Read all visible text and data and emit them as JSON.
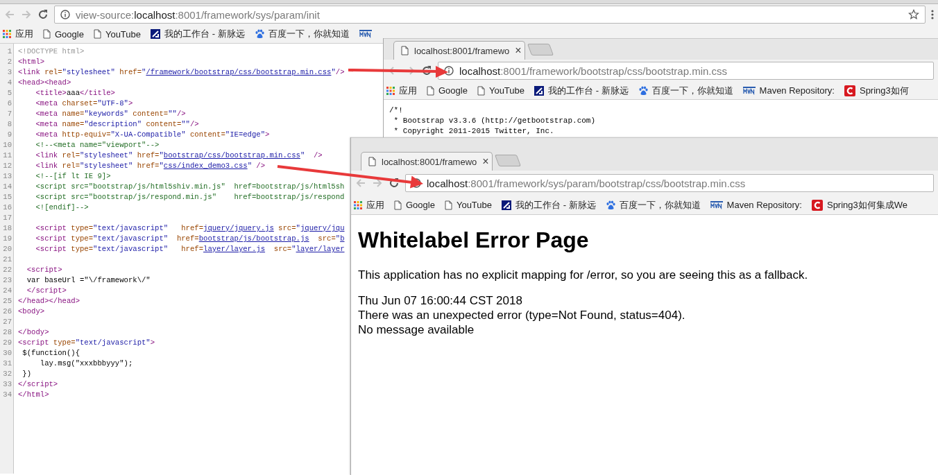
{
  "main_window": {
    "address": {
      "prefix": "view-source:",
      "host": "localhost",
      "path": ":8001/framework/sys/param/init"
    },
    "bookmarks": [
      {
        "kind": "apps",
        "label": "应用"
      },
      {
        "kind": "page",
        "label": "Google"
      },
      {
        "kind": "page",
        "label": "YouTube"
      },
      {
        "kind": "workbench",
        "label": "我的工作台 - 新脉远"
      },
      {
        "kind": "paw",
        "label": "百度一下，你就知道"
      },
      {
        "kind": "mvn"
      }
    ],
    "source_lines": [
      {
        "number": "1",
        "segments": [
          {
            "kind": "doctype",
            "text": "<!DOCTYPE html>"
          }
        ]
      },
      {
        "number": "2",
        "segments": [
          {
            "kind": "tag",
            "text": "<html>"
          }
        ]
      },
      {
        "number": "3",
        "segments": [
          {
            "kind": "tag",
            "text": "<link "
          },
          {
            "kind": "attr",
            "text": "rel="
          },
          {
            "kind": "value",
            "text": "\"stylesheet\" "
          },
          {
            "kind": "attr",
            "text": "href="
          },
          {
            "kind": "value",
            "text": "\""
          },
          {
            "kind": "link",
            "text": "/framework/bootstrap/css/bootstrap.min.css"
          },
          {
            "kind": "value",
            "text": "\""
          },
          {
            "kind": "tag",
            "text": "/>"
          }
        ]
      },
      {
        "number": "4",
        "segments": [
          {
            "kind": "tag",
            "text": "<head><head>"
          }
        ]
      },
      {
        "number": "5",
        "segments": [
          {
            "kind": "tag",
            "text": "    <title>"
          },
          {
            "kind": "text",
            "text": "aaa"
          },
          {
            "kind": "tag",
            "text": "</title>"
          }
        ]
      },
      {
        "number": "6",
        "segments": [
          {
            "kind": "tag",
            "text": "    <meta "
          },
          {
            "kind": "attr",
            "text": "charset="
          },
          {
            "kind": "value",
            "text": "\"UTF-8\""
          },
          {
            "kind": "tag",
            "text": ">"
          }
        ]
      },
      {
        "number": "7",
        "segments": [
          {
            "kind": "tag",
            "text": "    <meta "
          },
          {
            "kind": "attr",
            "text": "name="
          },
          {
            "kind": "value",
            "text": "\"keywords\" "
          },
          {
            "kind": "attr",
            "text": "content="
          },
          {
            "kind": "value",
            "text": "\"\""
          },
          {
            "kind": "tag",
            "text": "/>"
          }
        ]
      },
      {
        "number": "8",
        "segments": [
          {
            "kind": "tag",
            "text": "    <meta "
          },
          {
            "kind": "attr",
            "text": "name="
          },
          {
            "kind": "value",
            "text": "\"description\" "
          },
          {
            "kind": "attr",
            "text": "content="
          },
          {
            "kind": "value",
            "text": "\"\""
          },
          {
            "kind": "tag",
            "text": "/>"
          }
        ]
      },
      {
        "number": "9",
        "segments": [
          {
            "kind": "tag",
            "text": "    <meta "
          },
          {
            "kind": "attr",
            "text": "http-equiv="
          },
          {
            "kind": "value",
            "text": "\"X-UA-Compatible\" "
          },
          {
            "kind": "attr",
            "text": "content="
          },
          {
            "kind": "value",
            "text": "\"IE=edge\""
          },
          {
            "kind": "tag",
            "text": ">"
          }
        ]
      },
      {
        "number": "10",
        "segments": [
          {
            "kind": "comment",
            "text": "    <!--<meta name=\"viewport\"-->"
          }
        ]
      },
      {
        "number": "11",
        "segments": [
          {
            "kind": "tag",
            "text": "    <link "
          },
          {
            "kind": "attr",
            "text": "rel="
          },
          {
            "kind": "value",
            "text": "\"stylesheet\" "
          },
          {
            "kind": "attr",
            "text": "href="
          },
          {
            "kind": "value",
            "text": "\""
          },
          {
            "kind": "link",
            "text": "bootstrap/css/bootstrap.min.css"
          },
          {
            "kind": "value",
            "text": "\"  "
          },
          {
            "kind": "tag",
            "text": "/>"
          }
        ]
      },
      {
        "number": "12",
        "segments": [
          {
            "kind": "tag",
            "text": "    <link "
          },
          {
            "kind": "attr",
            "text": "rel="
          },
          {
            "kind": "value",
            "text": "\"stylesheet\" "
          },
          {
            "kind": "attr",
            "text": "href="
          },
          {
            "kind": "value",
            "text": "\""
          },
          {
            "kind": "link",
            "text": "css/index_demo3.css"
          },
          {
            "kind": "value",
            "text": "\" "
          },
          {
            "kind": "tag",
            "text": "/>"
          }
        ]
      },
      {
        "number": "13",
        "segments": [
          {
            "kind": "comment",
            "text": "    <!--[if lt IE 9]>"
          }
        ]
      },
      {
        "number": "14",
        "segments": [
          {
            "kind": "comment",
            "text": "    <script src=\"bootstrap/js/html5shiv.min.js\"  href=bootstrap/js/html5sh"
          }
        ]
      },
      {
        "number": "15",
        "segments": [
          {
            "kind": "comment",
            "text": "    <script src=\"bootstrap/js/respond.min.js\"    href=bootstrap/js/respond"
          }
        ]
      },
      {
        "number": "16",
        "segments": [
          {
            "kind": "comment",
            "text": "    <![endif]-->"
          }
        ]
      },
      {
        "number": "17"
      },
      {
        "number": "18",
        "segments": [
          {
            "kind": "tag",
            "text": "    <script "
          },
          {
            "kind": "attr",
            "text": "type="
          },
          {
            "kind": "value",
            "text": "\"text/javascript\"   "
          },
          {
            "kind": "attr",
            "text": "href="
          },
          {
            "kind": "link",
            "text": "jquery/jquery.js"
          },
          {
            "kind": "attr",
            "text": " src="
          },
          {
            "kind": "value",
            "text": "\""
          },
          {
            "kind": "link",
            "text": "jquery/jqu"
          }
        ]
      },
      {
        "number": "19",
        "segments": [
          {
            "kind": "tag",
            "text": "    <script "
          },
          {
            "kind": "attr",
            "text": "type="
          },
          {
            "kind": "value",
            "text": "\"text/javascript\"  "
          },
          {
            "kind": "attr",
            "text": "href="
          },
          {
            "kind": "link",
            "text": "bootstrap/js/bootstrap.js"
          },
          {
            "kind": "attr",
            "text": "  src="
          },
          {
            "kind": "value",
            "text": "\""
          },
          {
            "kind": "link",
            "text": "b"
          }
        ]
      },
      {
        "number": "20",
        "segments": [
          {
            "kind": "tag",
            "text": "    <script "
          },
          {
            "kind": "attr",
            "text": "type="
          },
          {
            "kind": "value",
            "text": "\"text/javascript\"   "
          },
          {
            "kind": "attr",
            "text": "href="
          },
          {
            "kind": "link",
            "text": "layer/layer.js"
          },
          {
            "kind": "attr",
            "text": "  src="
          },
          {
            "kind": "value",
            "text": "\""
          },
          {
            "kind": "link",
            "text": "layer/layer"
          }
        ]
      },
      {
        "number": "21"
      },
      {
        "number": "22",
        "segments": [
          {
            "kind": "tag",
            "text": "  <script>"
          }
        ]
      },
      {
        "number": "23",
        "segments": [
          {
            "kind": "text",
            "text": "  var baseUrl =\"\\/framework\\/\""
          }
        ]
      },
      {
        "number": "24",
        "segments": [
          {
            "kind": "tag",
            "text": "  </script>"
          }
        ]
      },
      {
        "number": "25",
        "segments": [
          {
            "kind": "tag",
            "text": "</head></head>"
          }
        ]
      },
      {
        "number": "26",
        "segments": [
          {
            "kind": "tag",
            "text": "<body>"
          }
        ]
      },
      {
        "number": "27"
      },
      {
        "number": "28",
        "segments": [
          {
            "kind": "tag",
            "text": "</body>"
          }
        ]
      },
      {
        "number": "29",
        "segments": [
          {
            "kind": "tag",
            "text": "<script "
          },
          {
            "kind": "attr",
            "text": "type="
          },
          {
            "kind": "value",
            "text": "\"text/javascript\""
          },
          {
            "kind": "tag",
            "text": ">"
          }
        ]
      },
      {
        "number": "30",
        "segments": [
          {
            "kind": "text",
            "text": " $(function(){"
          }
        ]
      },
      {
        "number": "31",
        "segments": [
          {
            "kind": "text",
            "text": "     lay.msg(\"xxxbbbyyy\");"
          }
        ]
      },
      {
        "number": "32",
        "segments": [
          {
            "kind": "text",
            "text": " })"
          }
        ]
      },
      {
        "number": "33",
        "segments": [
          {
            "kind": "tag",
            "text": "</script>"
          }
        ]
      },
      {
        "number": "34",
        "segments": [
          {
            "kind": "tag",
            "text": "</html>"
          }
        ]
      }
    ]
  },
  "windows": [
    {
      "tab": {
        "title": "localhost:8001/framewo",
        "close": "×"
      },
      "address": {
        "host": "localhost",
        "path": ":8001/framework/bootstrap/css/bootstrap.min.css"
      },
      "bookmarks": [
        {
          "kind": "apps",
          "label": "应用"
        },
        {
          "kind": "page",
          "label": "Google"
        },
        {
          "kind": "page",
          "label": "YouTube"
        },
        {
          "kind": "workbench",
          "label": "我的工作台 - 新脉远"
        },
        {
          "kind": "paw",
          "label": "百度一下，你就知道"
        },
        {
          "kind": "mvn",
          "label": "Maven Repository:"
        },
        {
          "kind": "spring",
          "label": "Spring3如何"
        }
      ],
      "content": {
        "kind": "plain",
        "lines": [
          "/*!",
          " * Bootstrap v3.3.6 (http://getbootstrap.com)",
          " * Copyright 2011-2015 Twitter, Inc."
        ]
      }
    },
    {
      "tab": {
        "title": "localhost:8001/framewo",
        "close": "×"
      },
      "address": {
        "host": "localhost",
        "path": ":8001/framework/sys/param/bootstrap/css/bootstrap.min.css"
      },
      "bookmarks": [
        {
          "kind": "apps",
          "label": "应用"
        },
        {
          "kind": "page",
          "label": "Google"
        },
        {
          "kind": "page",
          "label": "YouTube"
        },
        {
          "kind": "workbench",
          "label": "我的工作台 - 新脉远"
        },
        {
          "kind": "paw",
          "label": "百度一下，你就知道"
        },
        {
          "kind": "mvn",
          "label": "Maven Repository:"
        },
        {
          "kind": "spring",
          "label": "Spring3如何集成We"
        }
      ],
      "content": {
        "kind": "error_page",
        "heading": "Whitelabel Error Page",
        "message": "This application has no explicit mapping for /error, so you are seeing this as a fallback.",
        "details": [
          "Thu Jun 07 16:00:44 CST 2018",
          "There was an unexpected error (type=Not Found, status=404).",
          "No message available"
        ]
      }
    }
  ]
}
